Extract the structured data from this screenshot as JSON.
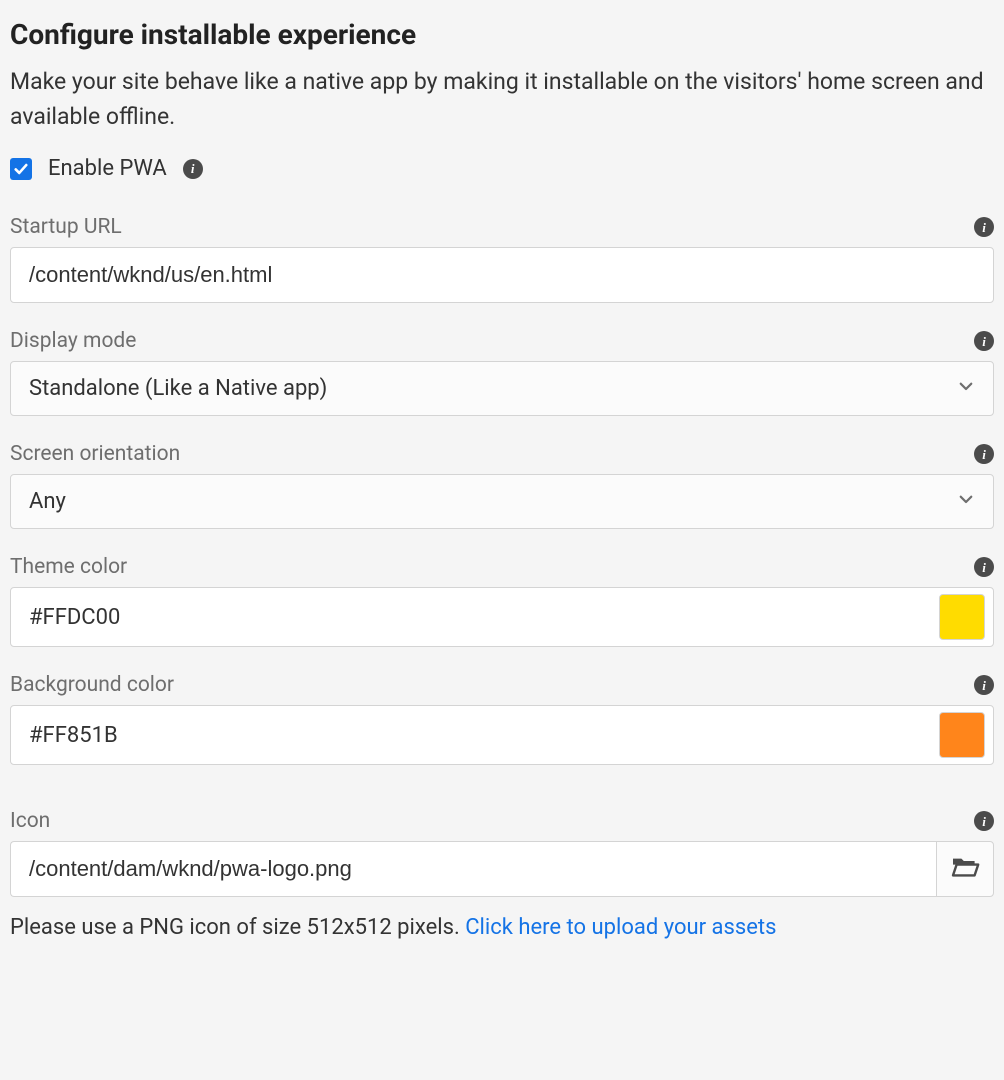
{
  "header": {
    "title": "Configure installable experience",
    "subtitle": "Make your site behave like a native app by making it installable on the visitors' home screen and available offline."
  },
  "enable": {
    "label": "Enable PWA",
    "checked": true
  },
  "fields": {
    "startup_url": {
      "label": "Startup URL",
      "value": "/content/wknd/us/en.html"
    },
    "display_mode": {
      "label": "Display mode",
      "value": "Standalone (Like a Native app)"
    },
    "screen_orientation": {
      "label": "Screen orientation",
      "value": "Any"
    },
    "theme_color": {
      "label": "Theme color",
      "value": "#FFDC00",
      "swatch": "#FFDC00"
    },
    "background_color": {
      "label": "Background color",
      "value": "#FF851B",
      "swatch": "#FF851B"
    },
    "icon": {
      "label": "Icon",
      "value": "/content/dam/wknd/pwa-logo.png"
    }
  },
  "hint": {
    "text": "Please use a PNG icon of size 512x512 pixels. ",
    "link": "Click here to upload your assets"
  }
}
